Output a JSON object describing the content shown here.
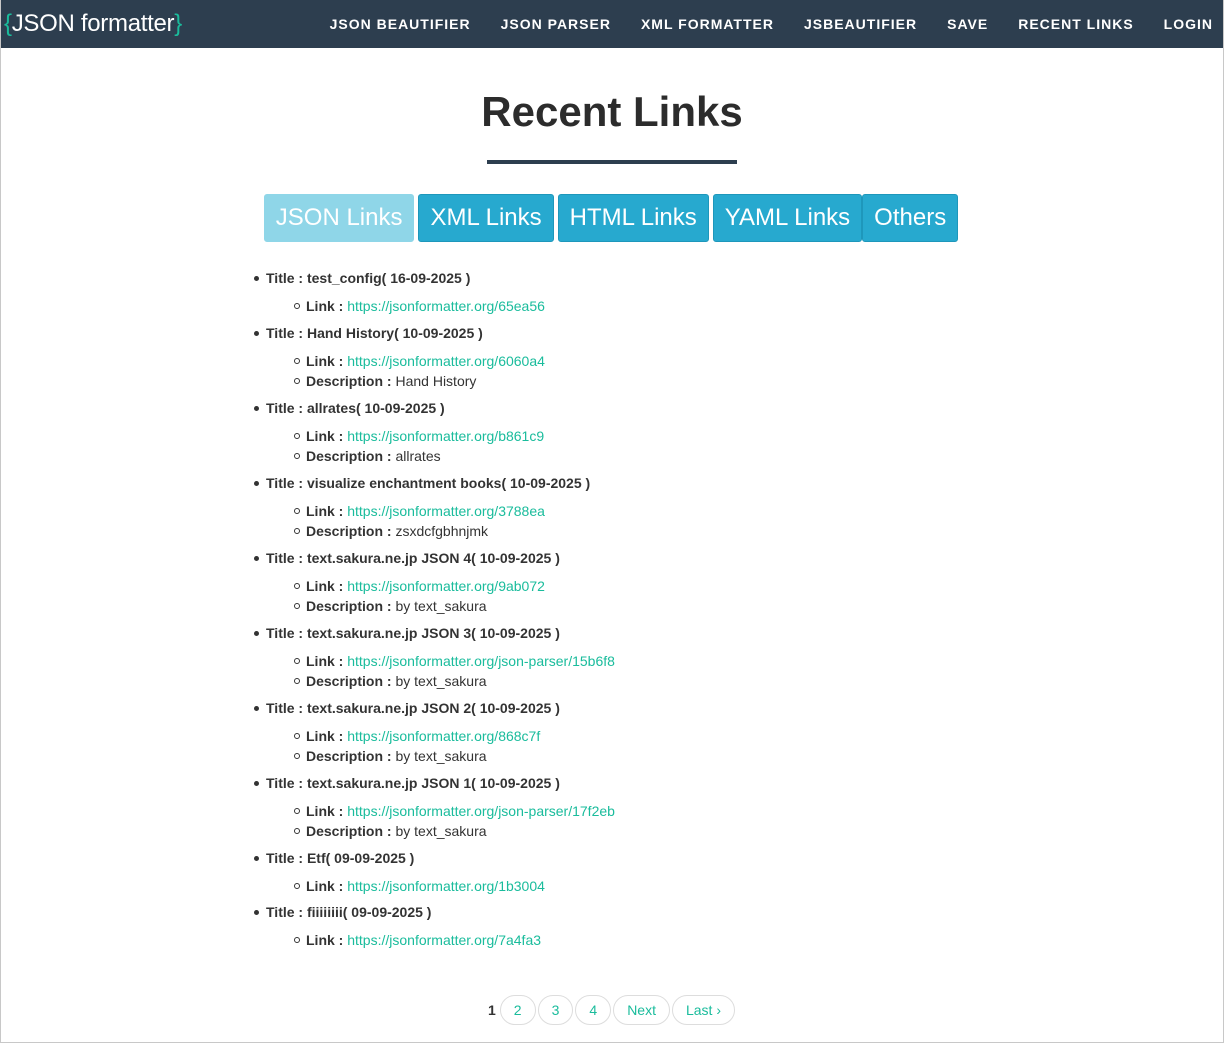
{
  "nav": {
    "brand_open": "{",
    "brand_text": "JSON formatter",
    "brand_close": "}",
    "links": [
      "JSON BEAUTIFIER",
      "JSON PARSER",
      "XML FORMATTER",
      "JSBEAUTIFIER",
      "SAVE",
      "RECENT LINKS",
      "LOGIN"
    ]
  },
  "page": {
    "title": "Recent Links"
  },
  "tabs": [
    "JSON Links",
    "XML Links",
    "HTML Links",
    "YAML Links",
    "Others"
  ],
  "active_tab": "JSON Links",
  "labels": {
    "title": "Title :",
    "link": "Link :",
    "description": "Description :"
  },
  "entries": [
    {
      "title": "test_config( 16-09-2025 )",
      "link": "https://jsonformatter.org/65ea56"
    },
    {
      "title": "Hand History( 10-09-2025 )",
      "link": "https://jsonformatter.org/6060a4",
      "description": "Hand History"
    },
    {
      "title": "allrates( 10-09-2025 )",
      "link": "https://jsonformatter.org/b861c9",
      "description": "allrates"
    },
    {
      "title": "visualize enchantment books( 10-09-2025 )",
      "link": "https://jsonformatter.org/3788ea",
      "description": "zsxdcfgbhnjmk"
    },
    {
      "title": "text.sakura.ne.jp JSON 4( 10-09-2025 )",
      "link": "https://jsonformatter.org/9ab072",
      "description": "by text_sakura"
    },
    {
      "title": "text.sakura.ne.jp JSON 3( 10-09-2025 )",
      "link": "https://jsonformatter.org/json-parser/15b6f8",
      "description": "by text_sakura"
    },
    {
      "title": "text.sakura.ne.jp JSON 2( 10-09-2025 )",
      "link": "https://jsonformatter.org/868c7f",
      "description": "by text_sakura"
    },
    {
      "title": "text.sakura.ne.jp JSON 1( 10-09-2025 )",
      "link": "https://jsonformatter.org/json-parser/17f2eb",
      "description": "by text_sakura"
    },
    {
      "title": "Etf( 09-09-2025 )",
      "link": "https://jsonformatter.org/1b3004"
    },
    {
      "title": "fiiiiiiii( 09-09-2025 )",
      "link": "https://jsonformatter.org/7a4fa3"
    }
  ],
  "pagination": {
    "current": "1",
    "pages": [
      "2",
      "3",
      "4"
    ],
    "next": "Next",
    "last": "Last ›"
  },
  "colors": {
    "navbar": "#2d3e4f",
    "accent": "#1abc9c",
    "tab": "#27a9cf",
    "tab_active": "#8fd6e8"
  }
}
